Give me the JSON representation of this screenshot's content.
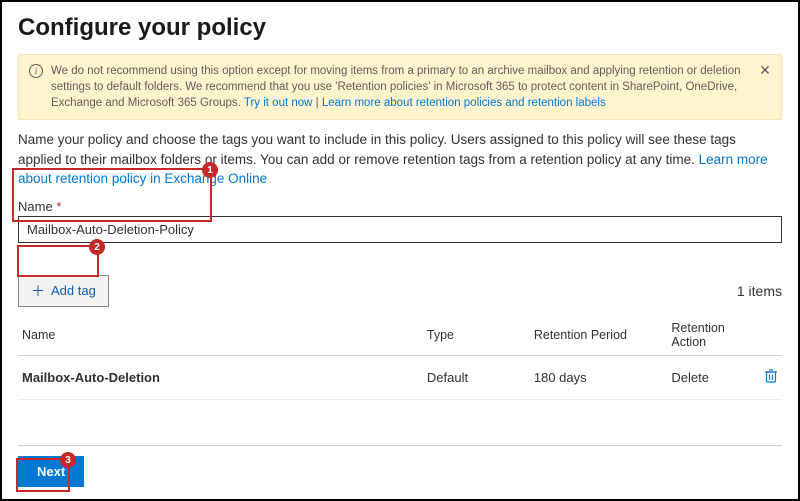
{
  "page_title": "Configure your policy",
  "info_bar": {
    "text_prefix": "We do not recommend using this option except for moving items from a primary to an archive mailbox and applying retention or deletion settings to default folders. We recommend that you use 'Retention policies' in Microsoft 365 to protect content in SharePoint, OneDrive, Exchange and Microsoft 365 Groups. ",
    "try_link": "Try it out now",
    "separator": " | ",
    "learn_link": "Learn more about retention policies and retention labels"
  },
  "description": {
    "text": "Name your policy and choose the tags you want to include in this policy. Users assigned to this policy will see these tags applied to their mailbox folders or items. You can add or remove retention tags from a retention policy at any time. ",
    "link": "Learn more about retention policy in Exchange Online"
  },
  "name_field": {
    "label": "Name",
    "required_marker": "*",
    "value": "Mailbox-Auto-Deletion-Policy"
  },
  "add_tag_button": "Add tag",
  "items_count": "1 items",
  "table": {
    "headers": {
      "name": "Name",
      "type": "Type",
      "retention_period": "Retention Period",
      "retention_action": "Retention Action"
    },
    "rows": [
      {
        "name": "Mailbox-Auto-Deletion",
        "type": "Default",
        "retention_period": "180 days",
        "retention_action": "Delete"
      }
    ]
  },
  "next_button": "Next",
  "callouts": {
    "c1": "1",
    "c2": "2",
    "c3": "3"
  },
  "colors": {
    "accent": "#0078d4",
    "warning_bg": "#fff4ce",
    "callout": "#c62828"
  }
}
